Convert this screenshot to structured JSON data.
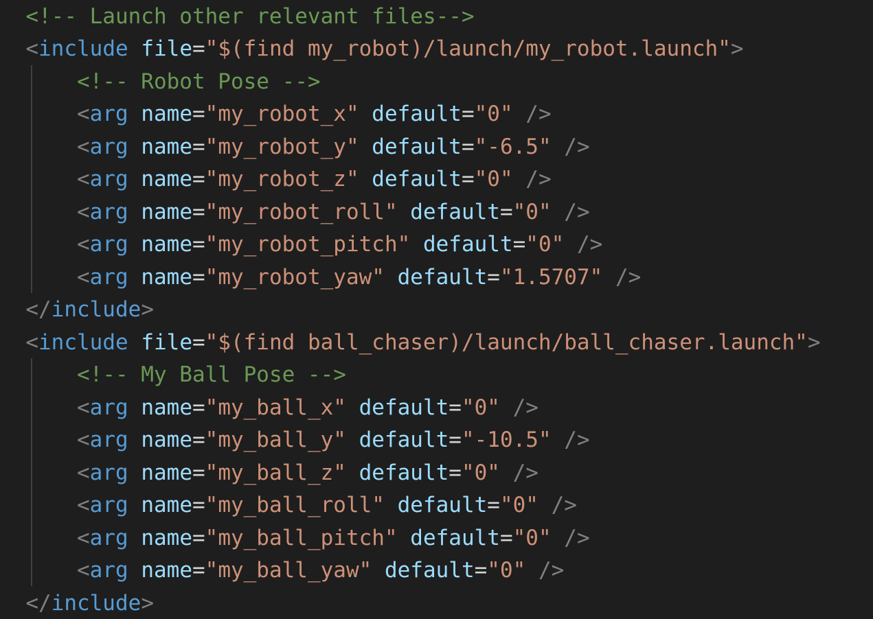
{
  "colors": {
    "background": "#1e1e1e",
    "comment": "#6a9955",
    "punctuation": "#808080",
    "tag": "#569cd6",
    "attribute": "#9cdcfe",
    "string": "#ce9178",
    "indent_guide": "#404040"
  },
  "lines": [
    {
      "indent": "  ",
      "tokens": [
        {
          "k": "c",
          "v": "<!-- Launch other relevant files-->"
        }
      ]
    },
    {
      "indent": "  ",
      "tokens": [
        {
          "k": "p",
          "v": "<"
        },
        {
          "k": "t",
          "v": "include"
        },
        {
          "k": "o",
          "v": " "
        },
        {
          "k": "a",
          "v": "file"
        },
        {
          "k": "o",
          "v": "="
        },
        {
          "k": "s",
          "v": "\"$(find my_robot)/launch/my_robot.launch\""
        },
        {
          "k": "p",
          "v": ">"
        }
      ]
    },
    {
      "indent": "      ",
      "tokens": [
        {
          "k": "c",
          "v": "<!-- Robot Pose -->"
        }
      ]
    },
    {
      "indent": "      ",
      "tokens": [
        {
          "k": "p",
          "v": "<"
        },
        {
          "k": "t",
          "v": "arg"
        },
        {
          "k": "o",
          "v": " "
        },
        {
          "k": "a",
          "v": "name"
        },
        {
          "k": "o",
          "v": "="
        },
        {
          "k": "s",
          "v": "\"my_robot_x\""
        },
        {
          "k": "o",
          "v": " "
        },
        {
          "k": "a",
          "v": "default"
        },
        {
          "k": "o",
          "v": "="
        },
        {
          "k": "s",
          "v": "\"0\""
        },
        {
          "k": "o",
          "v": " "
        },
        {
          "k": "p",
          "v": "/>"
        }
      ]
    },
    {
      "indent": "      ",
      "tokens": [
        {
          "k": "p",
          "v": "<"
        },
        {
          "k": "t",
          "v": "arg"
        },
        {
          "k": "o",
          "v": " "
        },
        {
          "k": "a",
          "v": "name"
        },
        {
          "k": "o",
          "v": "="
        },
        {
          "k": "s",
          "v": "\"my_robot_y\""
        },
        {
          "k": "o",
          "v": " "
        },
        {
          "k": "a",
          "v": "default"
        },
        {
          "k": "o",
          "v": "="
        },
        {
          "k": "s",
          "v": "\"-6.5\""
        },
        {
          "k": "o",
          "v": " "
        },
        {
          "k": "p",
          "v": "/>"
        }
      ]
    },
    {
      "indent": "      ",
      "tokens": [
        {
          "k": "p",
          "v": "<"
        },
        {
          "k": "t",
          "v": "arg"
        },
        {
          "k": "o",
          "v": " "
        },
        {
          "k": "a",
          "v": "name"
        },
        {
          "k": "o",
          "v": "="
        },
        {
          "k": "s",
          "v": "\"my_robot_z\""
        },
        {
          "k": "o",
          "v": " "
        },
        {
          "k": "a",
          "v": "default"
        },
        {
          "k": "o",
          "v": "="
        },
        {
          "k": "s",
          "v": "\"0\""
        },
        {
          "k": "o",
          "v": " "
        },
        {
          "k": "p",
          "v": "/>"
        }
      ]
    },
    {
      "indent": "      ",
      "tokens": [
        {
          "k": "p",
          "v": "<"
        },
        {
          "k": "t",
          "v": "arg"
        },
        {
          "k": "o",
          "v": " "
        },
        {
          "k": "a",
          "v": "name"
        },
        {
          "k": "o",
          "v": "="
        },
        {
          "k": "s",
          "v": "\"my_robot_roll\""
        },
        {
          "k": "o",
          "v": " "
        },
        {
          "k": "a",
          "v": "default"
        },
        {
          "k": "o",
          "v": "="
        },
        {
          "k": "s",
          "v": "\"0\""
        },
        {
          "k": "o",
          "v": " "
        },
        {
          "k": "p",
          "v": "/>"
        }
      ]
    },
    {
      "indent": "      ",
      "tokens": [
        {
          "k": "p",
          "v": "<"
        },
        {
          "k": "t",
          "v": "arg"
        },
        {
          "k": "o",
          "v": " "
        },
        {
          "k": "a",
          "v": "name"
        },
        {
          "k": "o",
          "v": "="
        },
        {
          "k": "s",
          "v": "\"my_robot_pitch\""
        },
        {
          "k": "o",
          "v": " "
        },
        {
          "k": "a",
          "v": "default"
        },
        {
          "k": "o",
          "v": "="
        },
        {
          "k": "s",
          "v": "\"0\""
        },
        {
          "k": "o",
          "v": " "
        },
        {
          "k": "p",
          "v": "/>"
        }
      ]
    },
    {
      "indent": "      ",
      "tokens": [
        {
          "k": "p",
          "v": "<"
        },
        {
          "k": "t",
          "v": "arg"
        },
        {
          "k": "o",
          "v": " "
        },
        {
          "k": "a",
          "v": "name"
        },
        {
          "k": "o",
          "v": "="
        },
        {
          "k": "s",
          "v": "\"my_robot_yaw\""
        },
        {
          "k": "o",
          "v": " "
        },
        {
          "k": "a",
          "v": "default"
        },
        {
          "k": "o",
          "v": "="
        },
        {
          "k": "s",
          "v": "\"1.5707\""
        },
        {
          "k": "o",
          "v": " "
        },
        {
          "k": "p",
          "v": "/>"
        }
      ]
    },
    {
      "indent": "  ",
      "tokens": [
        {
          "k": "p",
          "v": "</"
        },
        {
          "k": "t",
          "v": "include"
        },
        {
          "k": "p",
          "v": ">"
        }
      ]
    },
    {
      "indent": "  ",
      "tokens": [
        {
          "k": "p",
          "v": "<"
        },
        {
          "k": "t",
          "v": "include"
        },
        {
          "k": "o",
          "v": " "
        },
        {
          "k": "a",
          "v": "file"
        },
        {
          "k": "o",
          "v": "="
        },
        {
          "k": "s",
          "v": "\"$(find ball_chaser)/launch/ball_chaser.launch\""
        },
        {
          "k": "p",
          "v": ">"
        }
      ]
    },
    {
      "indent": "      ",
      "tokens": [
        {
          "k": "c",
          "v": "<!-- My Ball Pose -->"
        }
      ]
    },
    {
      "indent": "      ",
      "tokens": [
        {
          "k": "p",
          "v": "<"
        },
        {
          "k": "t",
          "v": "arg"
        },
        {
          "k": "o",
          "v": " "
        },
        {
          "k": "a",
          "v": "name"
        },
        {
          "k": "o",
          "v": "="
        },
        {
          "k": "s",
          "v": "\"my_ball_x\""
        },
        {
          "k": "o",
          "v": " "
        },
        {
          "k": "a",
          "v": "default"
        },
        {
          "k": "o",
          "v": "="
        },
        {
          "k": "s",
          "v": "\"0\""
        },
        {
          "k": "o",
          "v": " "
        },
        {
          "k": "p",
          "v": "/>"
        }
      ]
    },
    {
      "indent": "      ",
      "tokens": [
        {
          "k": "p",
          "v": "<"
        },
        {
          "k": "t",
          "v": "arg"
        },
        {
          "k": "o",
          "v": " "
        },
        {
          "k": "a",
          "v": "name"
        },
        {
          "k": "o",
          "v": "="
        },
        {
          "k": "s",
          "v": "\"my_ball_y\""
        },
        {
          "k": "o",
          "v": " "
        },
        {
          "k": "a",
          "v": "default"
        },
        {
          "k": "o",
          "v": "="
        },
        {
          "k": "s",
          "v": "\"-10.5\""
        },
        {
          "k": "o",
          "v": " "
        },
        {
          "k": "p",
          "v": "/>"
        }
      ]
    },
    {
      "indent": "      ",
      "tokens": [
        {
          "k": "p",
          "v": "<"
        },
        {
          "k": "t",
          "v": "arg"
        },
        {
          "k": "o",
          "v": " "
        },
        {
          "k": "a",
          "v": "name"
        },
        {
          "k": "o",
          "v": "="
        },
        {
          "k": "s",
          "v": "\"my_ball_z\""
        },
        {
          "k": "o",
          "v": " "
        },
        {
          "k": "a",
          "v": "default"
        },
        {
          "k": "o",
          "v": "="
        },
        {
          "k": "s",
          "v": "\"0\""
        },
        {
          "k": "o",
          "v": " "
        },
        {
          "k": "p",
          "v": "/>"
        }
      ]
    },
    {
      "indent": "      ",
      "tokens": [
        {
          "k": "p",
          "v": "<"
        },
        {
          "k": "t",
          "v": "arg"
        },
        {
          "k": "o",
          "v": " "
        },
        {
          "k": "a",
          "v": "name"
        },
        {
          "k": "o",
          "v": "="
        },
        {
          "k": "s",
          "v": "\"my_ball_roll\""
        },
        {
          "k": "o",
          "v": " "
        },
        {
          "k": "a",
          "v": "default"
        },
        {
          "k": "o",
          "v": "="
        },
        {
          "k": "s",
          "v": "\"0\""
        },
        {
          "k": "o",
          "v": " "
        },
        {
          "k": "p",
          "v": "/>"
        }
      ]
    },
    {
      "indent": "      ",
      "tokens": [
        {
          "k": "p",
          "v": "<"
        },
        {
          "k": "t",
          "v": "arg"
        },
        {
          "k": "o",
          "v": " "
        },
        {
          "k": "a",
          "v": "name"
        },
        {
          "k": "o",
          "v": "="
        },
        {
          "k": "s",
          "v": "\"my_ball_pitch\""
        },
        {
          "k": "o",
          "v": " "
        },
        {
          "k": "a",
          "v": "default"
        },
        {
          "k": "o",
          "v": "="
        },
        {
          "k": "s",
          "v": "\"0\""
        },
        {
          "k": "o",
          "v": " "
        },
        {
          "k": "p",
          "v": "/>"
        }
      ]
    },
    {
      "indent": "      ",
      "tokens": [
        {
          "k": "p",
          "v": "<"
        },
        {
          "k": "t",
          "v": "arg"
        },
        {
          "k": "o",
          "v": " "
        },
        {
          "k": "a",
          "v": "name"
        },
        {
          "k": "o",
          "v": "="
        },
        {
          "k": "s",
          "v": "\"my_ball_yaw\""
        },
        {
          "k": "o",
          "v": " "
        },
        {
          "k": "a",
          "v": "default"
        },
        {
          "k": "o",
          "v": "="
        },
        {
          "k": "s",
          "v": "\"0\""
        },
        {
          "k": "o",
          "v": " "
        },
        {
          "k": "p",
          "v": "/>"
        }
      ]
    },
    {
      "indent": "  ",
      "tokens": [
        {
          "k": "p",
          "v": "</"
        },
        {
          "k": "t",
          "v": "include"
        },
        {
          "k": "p",
          "v": ">"
        }
      ]
    }
  ]
}
